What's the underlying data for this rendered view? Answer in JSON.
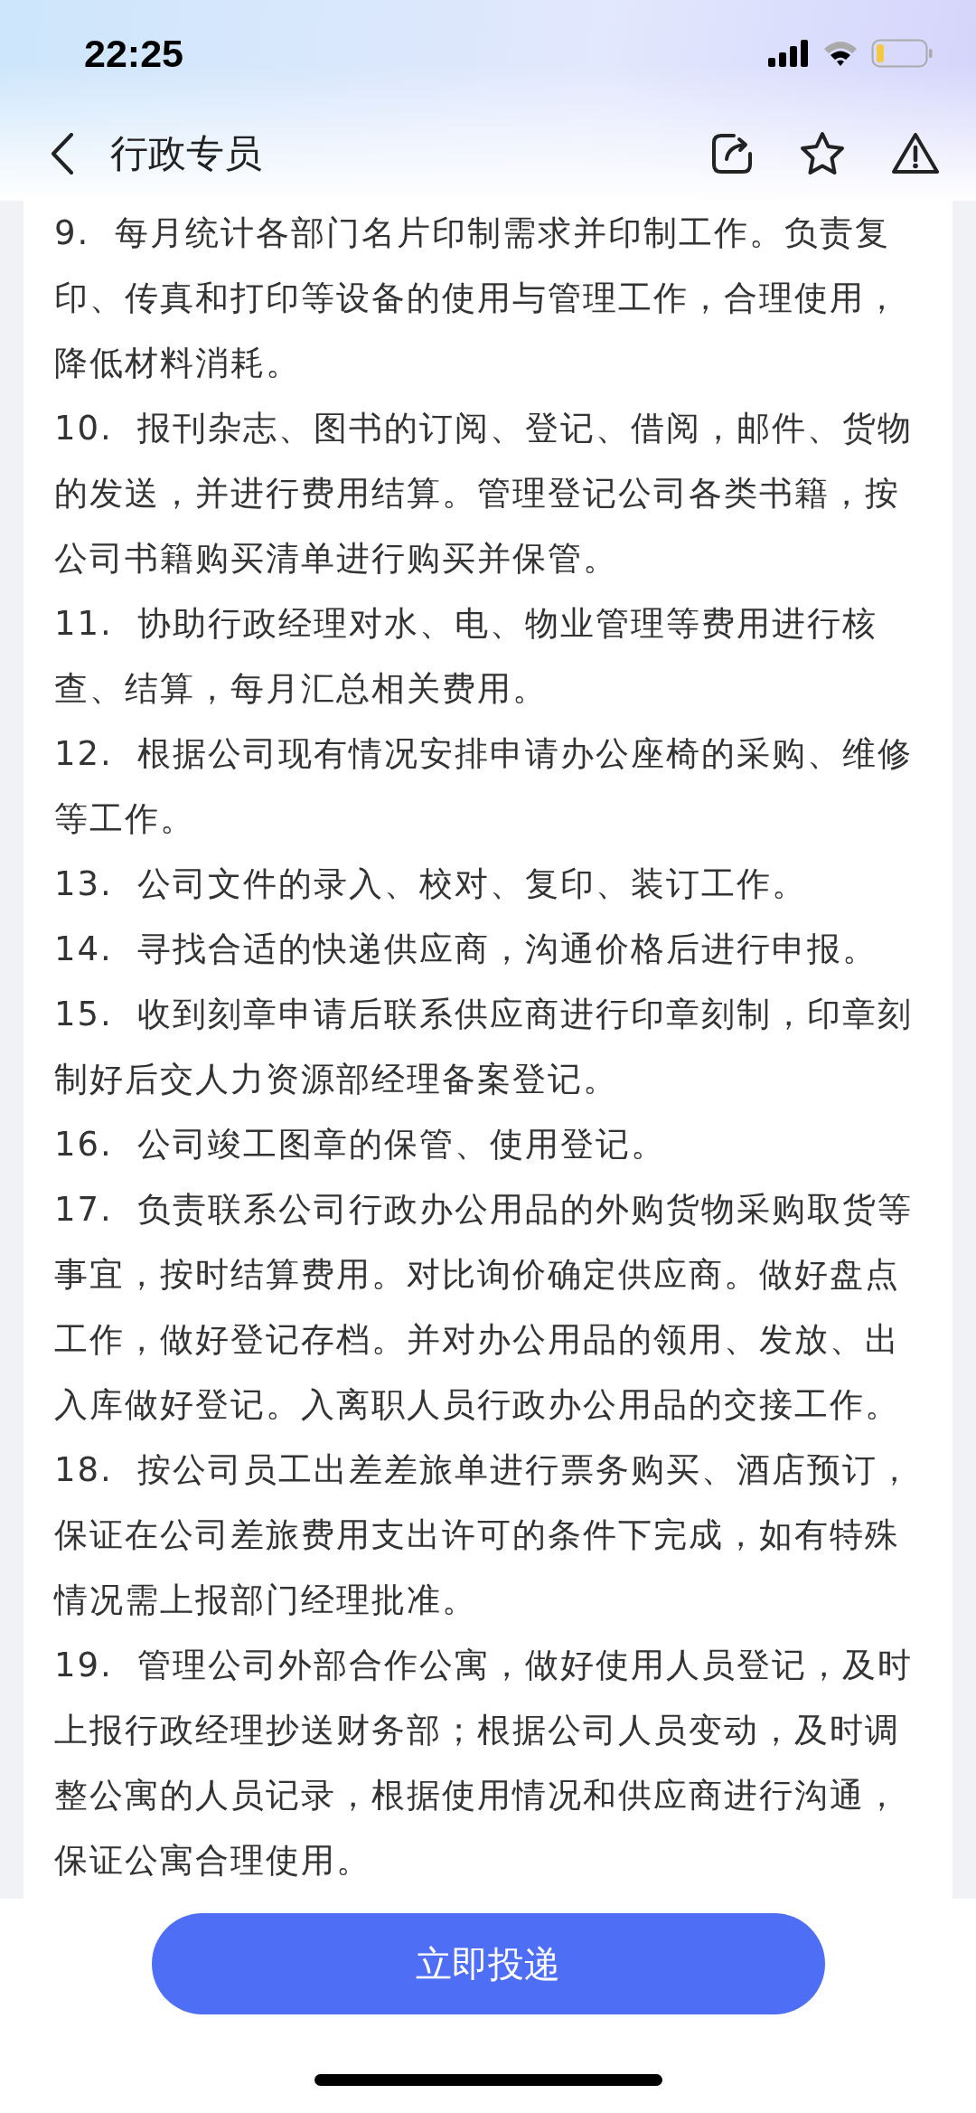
{
  "status_bar": {
    "time": "22:25"
  },
  "nav_bar": {
    "title": "行政专员"
  },
  "duties": [
    {
      "text": "9.  每月统计各部门名片印制需求并印制工作。负责复印、传真和打印等设备的使用与管理工作，合理使用，降低材料消耗。"
    },
    {
      "text": "10.  报刊杂志、图书的订阅、登记、借阅，邮件、货物的发送，并进行费用结算。管理登记公司各类书籍，按公司书籍购买清单进行购买并保管。"
    },
    {
      "text": "11.  协助行政经理对水、电、物业管理等费用进行核查、结算，每月汇总相关费用。"
    },
    {
      "text": "12.  根据公司现有情况安排申请办公座椅的采购、维修等工作。"
    },
    {
      "text": "13.  公司文件的录入、校对、复印、装订工作。"
    },
    {
      "text": "14.  寻找合适的快递供应商，沟通价格后进行申报。"
    },
    {
      "text": "15.  收到刻章申请后联系供应商进行印章刻制，印章刻制好后交人力资源部经理备案登记。"
    },
    {
      "text": "16.  公司竣工图章的保管、使用登记。"
    },
    {
      "text": "17.  负责联系公司行政办公用品的外购货物采购取货等事宜，按时结算费用。对比询价确定供应商。做好盘点工作，做好登记存档。并对办公用品的领用、发放、出入库做好登记。入离职人员行政办公用品的交接工作。"
    },
    {
      "text": "18.  按公司员工出差差旅单进行票务购买、酒店预订，保证在公司差旅费用支出许可的条件下完成，如有特殊情况需上报部门经理批准。"
    },
    {
      "text": "19.  管理公司外部合作公寓，做好使用人员登记，及时上报行政经理抄送财务部；根据公司人员变动，及时调整公寓的人员记录，根据使用情况和供应商进行沟通，保证公寓合理使用。"
    }
  ],
  "apply_button": {
    "label": "立即投递"
  }
}
